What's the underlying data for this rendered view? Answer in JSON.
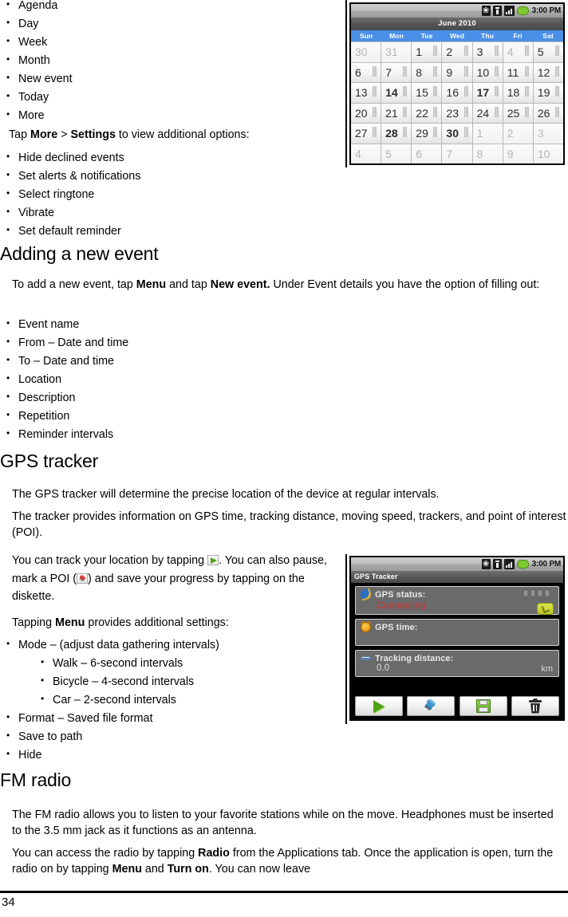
{
  "document": {
    "page_number": "34"
  },
  "calendar_menu_list": [
    "Agenda",
    "Day",
    "Week",
    "Month",
    "New event",
    "Today",
    "More"
  ],
  "settings_intro": {
    "prefix": "Tap ",
    "bold1": "More",
    "middle": " > ",
    "bold2": "Settings",
    "suffix": " to view additional options:"
  },
  "settings_list": [
    "Hide declined events",
    "Set alerts & notifications",
    "Select ringtone",
    "Vibrate",
    "Set default reminder"
  ],
  "adding_event": {
    "heading": "Adding a new event",
    "para_prefix": "To add a new event, tap ",
    "para_bold1": "Menu",
    "para_mid": " and tap ",
    "para_bold2": "New event.",
    "para_suffix": " Under Event details you have the option of filling out:",
    "items": [
      "Event name",
      "From – Date and time",
      "To – Date and time",
      "Location",
      "Description",
      "Repetition",
      "Reminder intervals"
    ]
  },
  "gps_tracker": {
    "heading": "GPS tracker",
    "para1": "The GPS tracker will determine the precise location of the device at regular intervals.",
    "para2": "The tracker provides information on GPS time, tracking distance, moving speed, trackers, and point of interest (POI).",
    "para3_a": "You can track your location by tapping ",
    "para3_b": ". You can also pause, mark a POI (",
    "para3_c": ") and save your progress by tapping on the diskette.",
    "para4_prefix": "Tapping ",
    "para4_bold": "Menu",
    "para4_suffix": " provides additional settings:",
    "settings": [
      {
        "label": "Mode –  (adjust data gathering intervals)",
        "children": [
          "Walk – 6-second intervals",
          "Bicycle – 4-second intervals",
          "Car – 2-second intervals"
        ]
      },
      {
        "label": "Format – Saved file format",
        "children": []
      },
      {
        "label": "Save to path",
        "children": []
      },
      {
        "label": "Hide",
        "children": []
      }
    ]
  },
  "fm_radio": {
    "heading": "FM radio",
    "para1": "The FM radio allows you to listen to your favorite stations while on the move. Headphones must be inserted to the 3.5 mm jack as it functions as an antenna.",
    "para2_a": "You can access the radio by tapping ",
    "para2_bold1": "Radio",
    "para2_b": " from the Applications tab. Once the application is open, turn the radio on by tapping ",
    "para2_bold2": "Menu",
    "para2_c": " and  ",
    "para2_bold3": "Turn on",
    "para2_d": ". You can now leave"
  },
  "calendar_screenshot": {
    "statusbar": {
      "time": "3:00 PM",
      "icons": [
        "bluetooth-icon",
        "sim-card-icon",
        "signal-bars-icon",
        "battery-icon"
      ]
    },
    "title": "June 2010",
    "weekdays": [
      "Sun",
      "Mon",
      "Tue",
      "Wed",
      "Thu",
      "Fri",
      "Sat"
    ],
    "weeks": [
      [
        {
          "d": "30",
          "dim": true,
          "mark": false,
          "bold": false
        },
        {
          "d": "31",
          "dim": true,
          "mark": false,
          "bold": false
        },
        {
          "d": "1",
          "dim": false,
          "mark": true,
          "bold": false
        },
        {
          "d": "2",
          "dim": false,
          "mark": true,
          "bold": false
        },
        {
          "d": "3",
          "dim": false,
          "mark": true,
          "bold": false
        },
        {
          "d": "4",
          "dim": true,
          "mark": true,
          "bold": false
        },
        {
          "d": "5",
          "dim": false,
          "mark": true,
          "bold": false
        }
      ],
      [
        {
          "d": "6",
          "dim": false,
          "mark": true,
          "bold": false
        },
        {
          "d": "7",
          "dim": false,
          "mark": true,
          "bold": false
        },
        {
          "d": "8",
          "dim": false,
          "mark": true,
          "bold": false
        },
        {
          "d": "9",
          "dim": false,
          "mark": true,
          "bold": false
        },
        {
          "d": "10",
          "dim": false,
          "mark": true,
          "bold": false
        },
        {
          "d": "11",
          "dim": false,
          "mark": true,
          "bold": false
        },
        {
          "d": "12",
          "dim": false,
          "mark": true,
          "bold": false
        }
      ],
      [
        {
          "d": "13",
          "dim": false,
          "mark": true,
          "bold": false
        },
        {
          "d": "14",
          "dim": false,
          "mark": true,
          "bold": true
        },
        {
          "d": "15",
          "dim": false,
          "mark": true,
          "bold": false
        },
        {
          "d": "16",
          "dim": false,
          "mark": true,
          "bold": false
        },
        {
          "d": "17",
          "dim": false,
          "mark": true,
          "bold": true
        },
        {
          "d": "18",
          "dim": false,
          "mark": true,
          "bold": false
        },
        {
          "d": "19",
          "dim": false,
          "mark": true,
          "bold": false
        }
      ],
      [
        {
          "d": "20",
          "dim": false,
          "mark": true,
          "bold": false
        },
        {
          "d": "21",
          "dim": false,
          "mark": true,
          "bold": false
        },
        {
          "d": "22",
          "dim": false,
          "mark": true,
          "bold": false
        },
        {
          "d": "23",
          "dim": false,
          "mark": true,
          "bold": false
        },
        {
          "d": "24",
          "dim": false,
          "mark": true,
          "bold": false
        },
        {
          "d": "25",
          "dim": false,
          "mark": true,
          "bold": false
        },
        {
          "d": "26",
          "dim": false,
          "mark": true,
          "bold": false
        }
      ],
      [
        {
          "d": "27",
          "dim": false,
          "mark": true,
          "bold": false
        },
        {
          "d": "28",
          "dim": false,
          "mark": true,
          "bold": true
        },
        {
          "d": "29",
          "dim": false,
          "mark": true,
          "bold": false
        },
        {
          "d": "30",
          "dim": false,
          "mark": true,
          "bold": true
        },
        {
          "d": "1",
          "dim": true,
          "mark": false,
          "bold": false
        },
        {
          "d": "2",
          "dim": true,
          "mark": false,
          "bold": false
        },
        {
          "d": "3",
          "dim": true,
          "mark": false,
          "bold": false
        }
      ],
      [
        {
          "d": "4",
          "dim": true,
          "mark": false,
          "bold": false
        },
        {
          "d": "5",
          "dim": true,
          "mark": false,
          "bold": false
        },
        {
          "d": "6",
          "dim": true,
          "mark": false,
          "bold": false
        },
        {
          "d": "7",
          "dim": true,
          "mark": false,
          "bold": false
        },
        {
          "d": "8",
          "dim": true,
          "mark": false,
          "bold": false
        },
        {
          "d": "9",
          "dim": true,
          "mark": false,
          "bold": false
        },
        {
          "d": "10",
          "dim": true,
          "mark": false,
          "bold": false
        }
      ]
    ]
  },
  "gps_screenshot": {
    "statusbar": {
      "time": "3:00 PM"
    },
    "title": "GPS Tracker",
    "cards": [
      {
        "icon": "satellite-icon",
        "label": "GPS status:",
        "value": "Connecting",
        "unit": "",
        "status": true
      },
      {
        "icon": "alarm-clock-icon",
        "label": "GPS time:",
        "value": "",
        "unit": "",
        "status": false
      },
      {
        "icon": "road-icon",
        "label": "Tracking distance:",
        "value": "0.0",
        "unit": "km",
        "status": false
      }
    ],
    "buttons": [
      "start-button",
      "mark-poi-button",
      "save-button",
      "delete-button"
    ],
    "colors": {
      "status_red": "#d42c2c",
      "card_bg": "#6a6a6a",
      "accent_green": "#5ca81d"
    }
  }
}
